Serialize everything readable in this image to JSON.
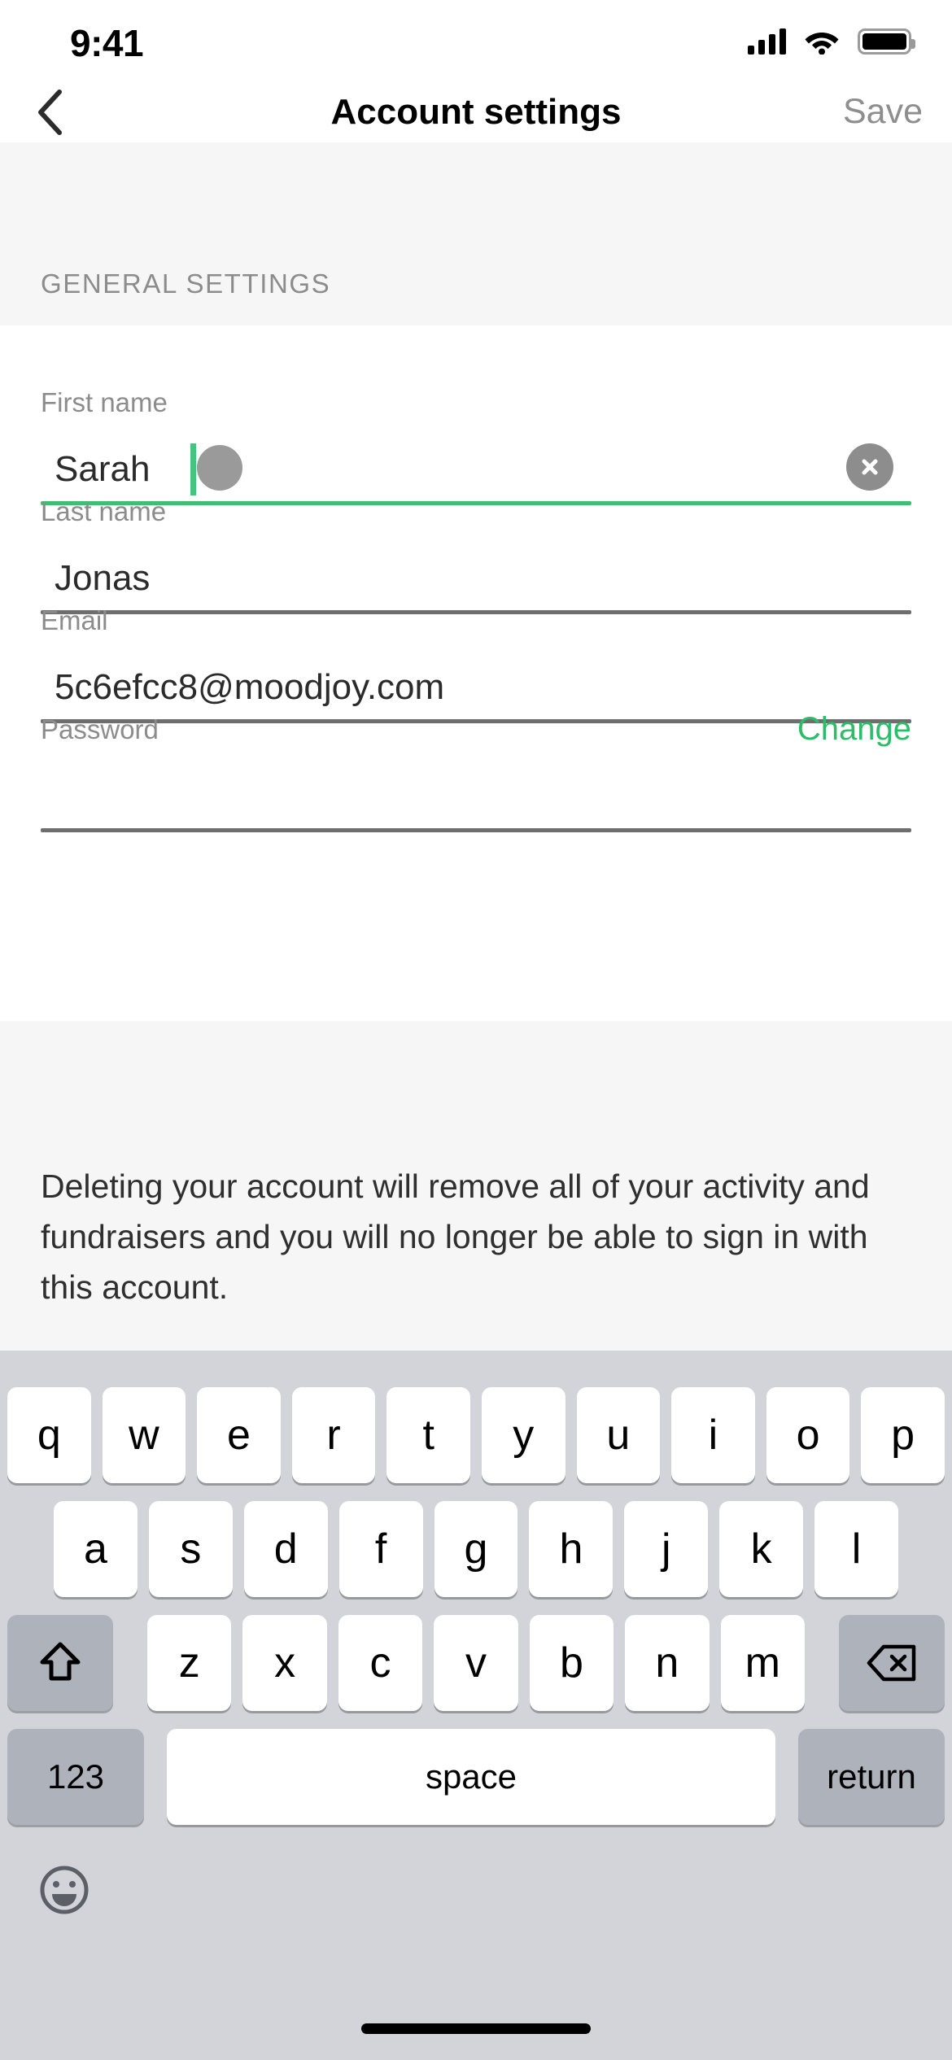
{
  "status_bar": {
    "time": "9:41",
    "signal_icon": "cellular-signal-icon",
    "wifi_icon": "wifi-icon",
    "battery_icon": "battery-icon"
  },
  "nav": {
    "back_icon": "chevron-left-icon",
    "title": "Account settings",
    "save_label": "Save"
  },
  "section": {
    "header": "GENERAL SETTINGS"
  },
  "fields": {
    "first_name": {
      "label": "First name",
      "value": "Sarah",
      "focused": true,
      "clear_icon": "clear-circle-icon",
      "underline_color": "#3fbf72"
    },
    "last_name": {
      "label": "Last name",
      "value": "Jonas",
      "underline_color": "#6e6e6e"
    },
    "email": {
      "label": "Email",
      "value": "5c6efcc8@moodjoy.com",
      "underline_color": "#6e6e6e"
    },
    "password": {
      "label": "Password",
      "value": "",
      "action_label": "Change",
      "action_color": "#2dbd69",
      "underline_color": "#6e6e6e"
    }
  },
  "notice": {
    "text": "Deleting your account will remove all of your activity and fundraisers and you will no longer be able to sign in with this account."
  },
  "keyboard": {
    "row1": [
      "q",
      "w",
      "e",
      "r",
      "t",
      "y",
      "u",
      "i",
      "o",
      "p"
    ],
    "row2": [
      "a",
      "s",
      "d",
      "f",
      "g",
      "h",
      "j",
      "k",
      "l"
    ],
    "row3": [
      "z",
      "x",
      "c",
      "v",
      "b",
      "n",
      "m"
    ],
    "shift_icon": "shift-arrow-icon",
    "backspace_icon": "backspace-delete-icon",
    "numbers_label": "123",
    "space_label": "space",
    "return_label": "return",
    "emoji_icon": "emoji-smiley-icon"
  },
  "colors": {
    "accent_green": "#3fbf72",
    "section_bg": "#f6f6f6",
    "keyboard_bg": "#d2d4d9",
    "key_fn_bg": "#aeb2ba"
  }
}
